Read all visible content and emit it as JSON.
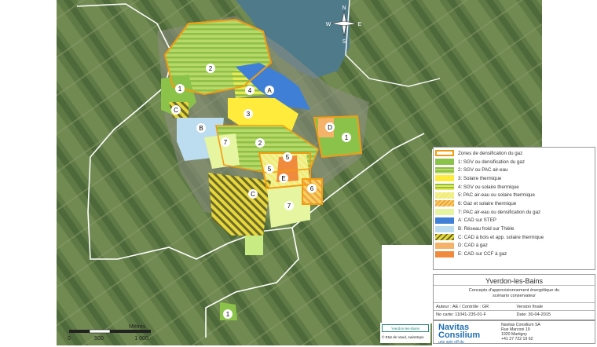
{
  "map": {
    "zone_labels": [
      {
        "id": "2",
        "text": "2"
      },
      {
        "id": "1a",
        "text": "1"
      },
      {
        "id": "ca",
        "text": "C"
      },
      {
        "id": "4",
        "text": "4"
      },
      {
        "id": "A",
        "text": "A"
      },
      {
        "id": "3",
        "text": "3"
      },
      {
        "id": "B",
        "text": "B"
      },
      {
        "id": "7a",
        "text": "7"
      },
      {
        "id": "2b",
        "text": "2"
      },
      {
        "id": "D",
        "text": "D"
      },
      {
        "id": "1b",
        "text": "1"
      },
      {
        "id": "5a",
        "text": "5"
      },
      {
        "id": "5b",
        "text": "5"
      },
      {
        "id": "E",
        "text": "E"
      },
      {
        "id": "cb",
        "text": "C"
      },
      {
        "id": "6",
        "text": "6"
      },
      {
        "id": "7b",
        "text": "7"
      },
      {
        "id": "1c",
        "text": "1"
      }
    ],
    "compass": {
      "n": "N",
      "s": "S",
      "e": "E",
      "w": "W"
    }
  },
  "legend": {
    "items": [
      {
        "label": "Zones de densification du gaz",
        "swatch": "outline-orange"
      },
      {
        "label": "1: SGV ou densification du gaz",
        "swatch": "#8bc34a"
      },
      {
        "label": "2: SGV ou PAC air-eau",
        "swatch": "stripe-green"
      },
      {
        "label": "3: Solaire thermique",
        "swatch": "#ffeb3b"
      },
      {
        "label": "4: SGV ou solaire thermique",
        "swatch": "stripe-green-yellow"
      },
      {
        "label": "5: PAC air-eau ou solaire thermique",
        "swatch": "stripe-light-yellow"
      },
      {
        "label": "6: Gaz et solaire thermique",
        "swatch": "stripe-yellow-orange"
      },
      {
        "label": "7: PAC air-eau ou densification du gaz",
        "swatch": "#e6f5a0"
      },
      {
        "label": "A: CAD sur STEP",
        "swatch": "#3f7fd6"
      },
      {
        "label": "B: Réseau froid sur Thièle",
        "swatch": "#bcdcf0"
      },
      {
        "label": "C: CAD à bois et app. solaire thermique",
        "swatch": "stripe-dark-yellow"
      },
      {
        "label": "D: CAD à gaz",
        "swatch": "#f5b36a"
      },
      {
        "label": "E: CAD sur CCF à gaz",
        "swatch": "#f08a3c"
      }
    ]
  },
  "titlebox": {
    "title": "Yverdon-les-Bains",
    "subtitle_1": "Concepts d'approvisionnement énergétique du",
    "subtitle_2": "scénario conservateur",
    "author": "Auteur : AE / Contrôle : GR",
    "version": "Version finale",
    "card_no": "No carte: 11041-235-01-F",
    "date": "Date: 30-04-2015"
  },
  "company": {
    "brand_1": "Navitas",
    "brand_2": "Consilium",
    "tagline": "une spin off du",
    "address_name": "Navitas Consilium SA",
    "street": "Rue Marconi 19",
    "city": "1920 Martigny",
    "phone": "+41 27 722 19 62"
  },
  "scale": {
    "unit": "Mètres",
    "ticks": [
      "0",
      "500",
      "1 000"
    ]
  },
  "credits": {
    "partner": "Yverdon-les-Bains",
    "source": "© Etat de Vaud, swisstopo"
  }
}
